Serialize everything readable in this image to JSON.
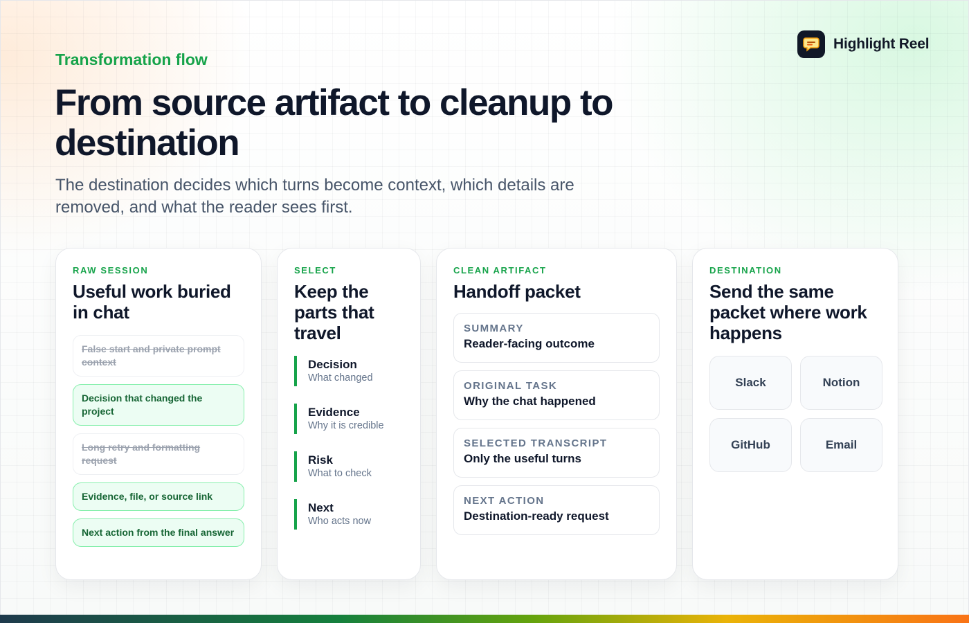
{
  "brand": {
    "name": "Highlight Reel",
    "logo_icon": "chat-bubble-icon"
  },
  "header": {
    "eyebrow": "Transformation flow",
    "title": "From source artifact to cleanup to destination",
    "subtitle": "The destination decides which turns become context, which details are removed, and what the reader sees first."
  },
  "cards": {
    "raw": {
      "label": "RAW SESSION",
      "title": "Useful work buried in chat",
      "items": [
        {
          "text": "False start and private prompt context",
          "status": "dropped"
        },
        {
          "text": "Decision that changed the project",
          "status": "kept"
        },
        {
          "text": "Long retry and formatting request",
          "status": "dropped"
        },
        {
          "text": "Evidence, file, or source link",
          "status": "kept"
        },
        {
          "text": "Next action from the final answer",
          "status": "kept"
        }
      ]
    },
    "select": {
      "label": "SELECT",
      "title": "Keep the parts that travel",
      "items": [
        {
          "title": "Decision",
          "sub": "What changed"
        },
        {
          "title": "Evidence",
          "sub": "Why it is credible"
        },
        {
          "title": "Risk",
          "sub": "What to check"
        },
        {
          "title": "Next",
          "sub": "Who acts now"
        }
      ]
    },
    "clean": {
      "label": "CLEAN ARTIFACT",
      "title": "Handoff packet",
      "items": [
        {
          "label": "SUMMARY",
          "value": "Reader-facing outcome"
        },
        {
          "label": "ORIGINAL TASK",
          "value": "Why the chat happened"
        },
        {
          "label": "SELECTED TRANSCRIPT",
          "value": "Only the useful turns"
        },
        {
          "label": "NEXT ACTION",
          "value": "Destination-ready request"
        }
      ]
    },
    "destination": {
      "label": "DESTINATION",
      "title": "Send the same packet where work happens",
      "targets": [
        "Slack",
        "Notion",
        "GitHub",
        "Email"
      ]
    }
  },
  "colors": {
    "accent": "#16a34a",
    "kept_bg": "#ecfdf3",
    "kept_border": "#86efac",
    "bar_start": "#1e3a4c",
    "bar_end": "#f97316"
  }
}
